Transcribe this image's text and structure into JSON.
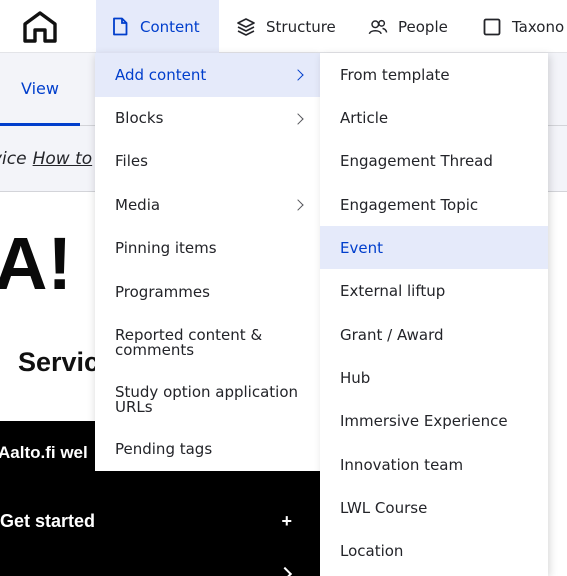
{
  "toolbar": {
    "home_icon": "home-icon",
    "items": [
      {
        "label": "Content",
        "icon": "document-icon"
      },
      {
        "label": "Structure",
        "icon": "layers-icon"
      },
      {
        "label": "People",
        "icon": "people-icon"
      },
      {
        "label": "Taxono",
        "icon": "square-icon"
      }
    ],
    "accent": "#003ecc",
    "active_bg": "#e5eafa"
  },
  "page": {
    "tab_view": "View",
    "crumb_prefix": "vice",
    "crumb_link": "How to",
    "heading_partial": "A!",
    "subheading_partial": "Servic",
    "panel_title": "Aalto.fi wel",
    "panel_row": "Get started",
    "panel_row_icon": "+"
  },
  "content_menu": {
    "items": [
      {
        "label": "Add content",
        "submenu": true
      },
      {
        "label": "Blocks",
        "submenu": true
      },
      {
        "label": "Files",
        "submenu": false
      },
      {
        "label": "Media",
        "submenu": true
      },
      {
        "label": "Pinning items",
        "submenu": false
      },
      {
        "label": "Programmes",
        "submenu": false
      },
      {
        "label": "Reported content & comments",
        "submenu": false
      },
      {
        "label": "Study option application URLs",
        "submenu": false
      },
      {
        "label": "Pending tags",
        "submenu": false
      }
    ]
  },
  "add_content_menu": {
    "items": [
      "From template",
      "Article",
      "Engagement Thread",
      "Engagement Topic",
      "Event",
      "External liftup",
      "Grant / Award",
      "Hub",
      "Immersive Experience",
      "Innovation team",
      "LWL Course",
      "Location"
    ]
  }
}
